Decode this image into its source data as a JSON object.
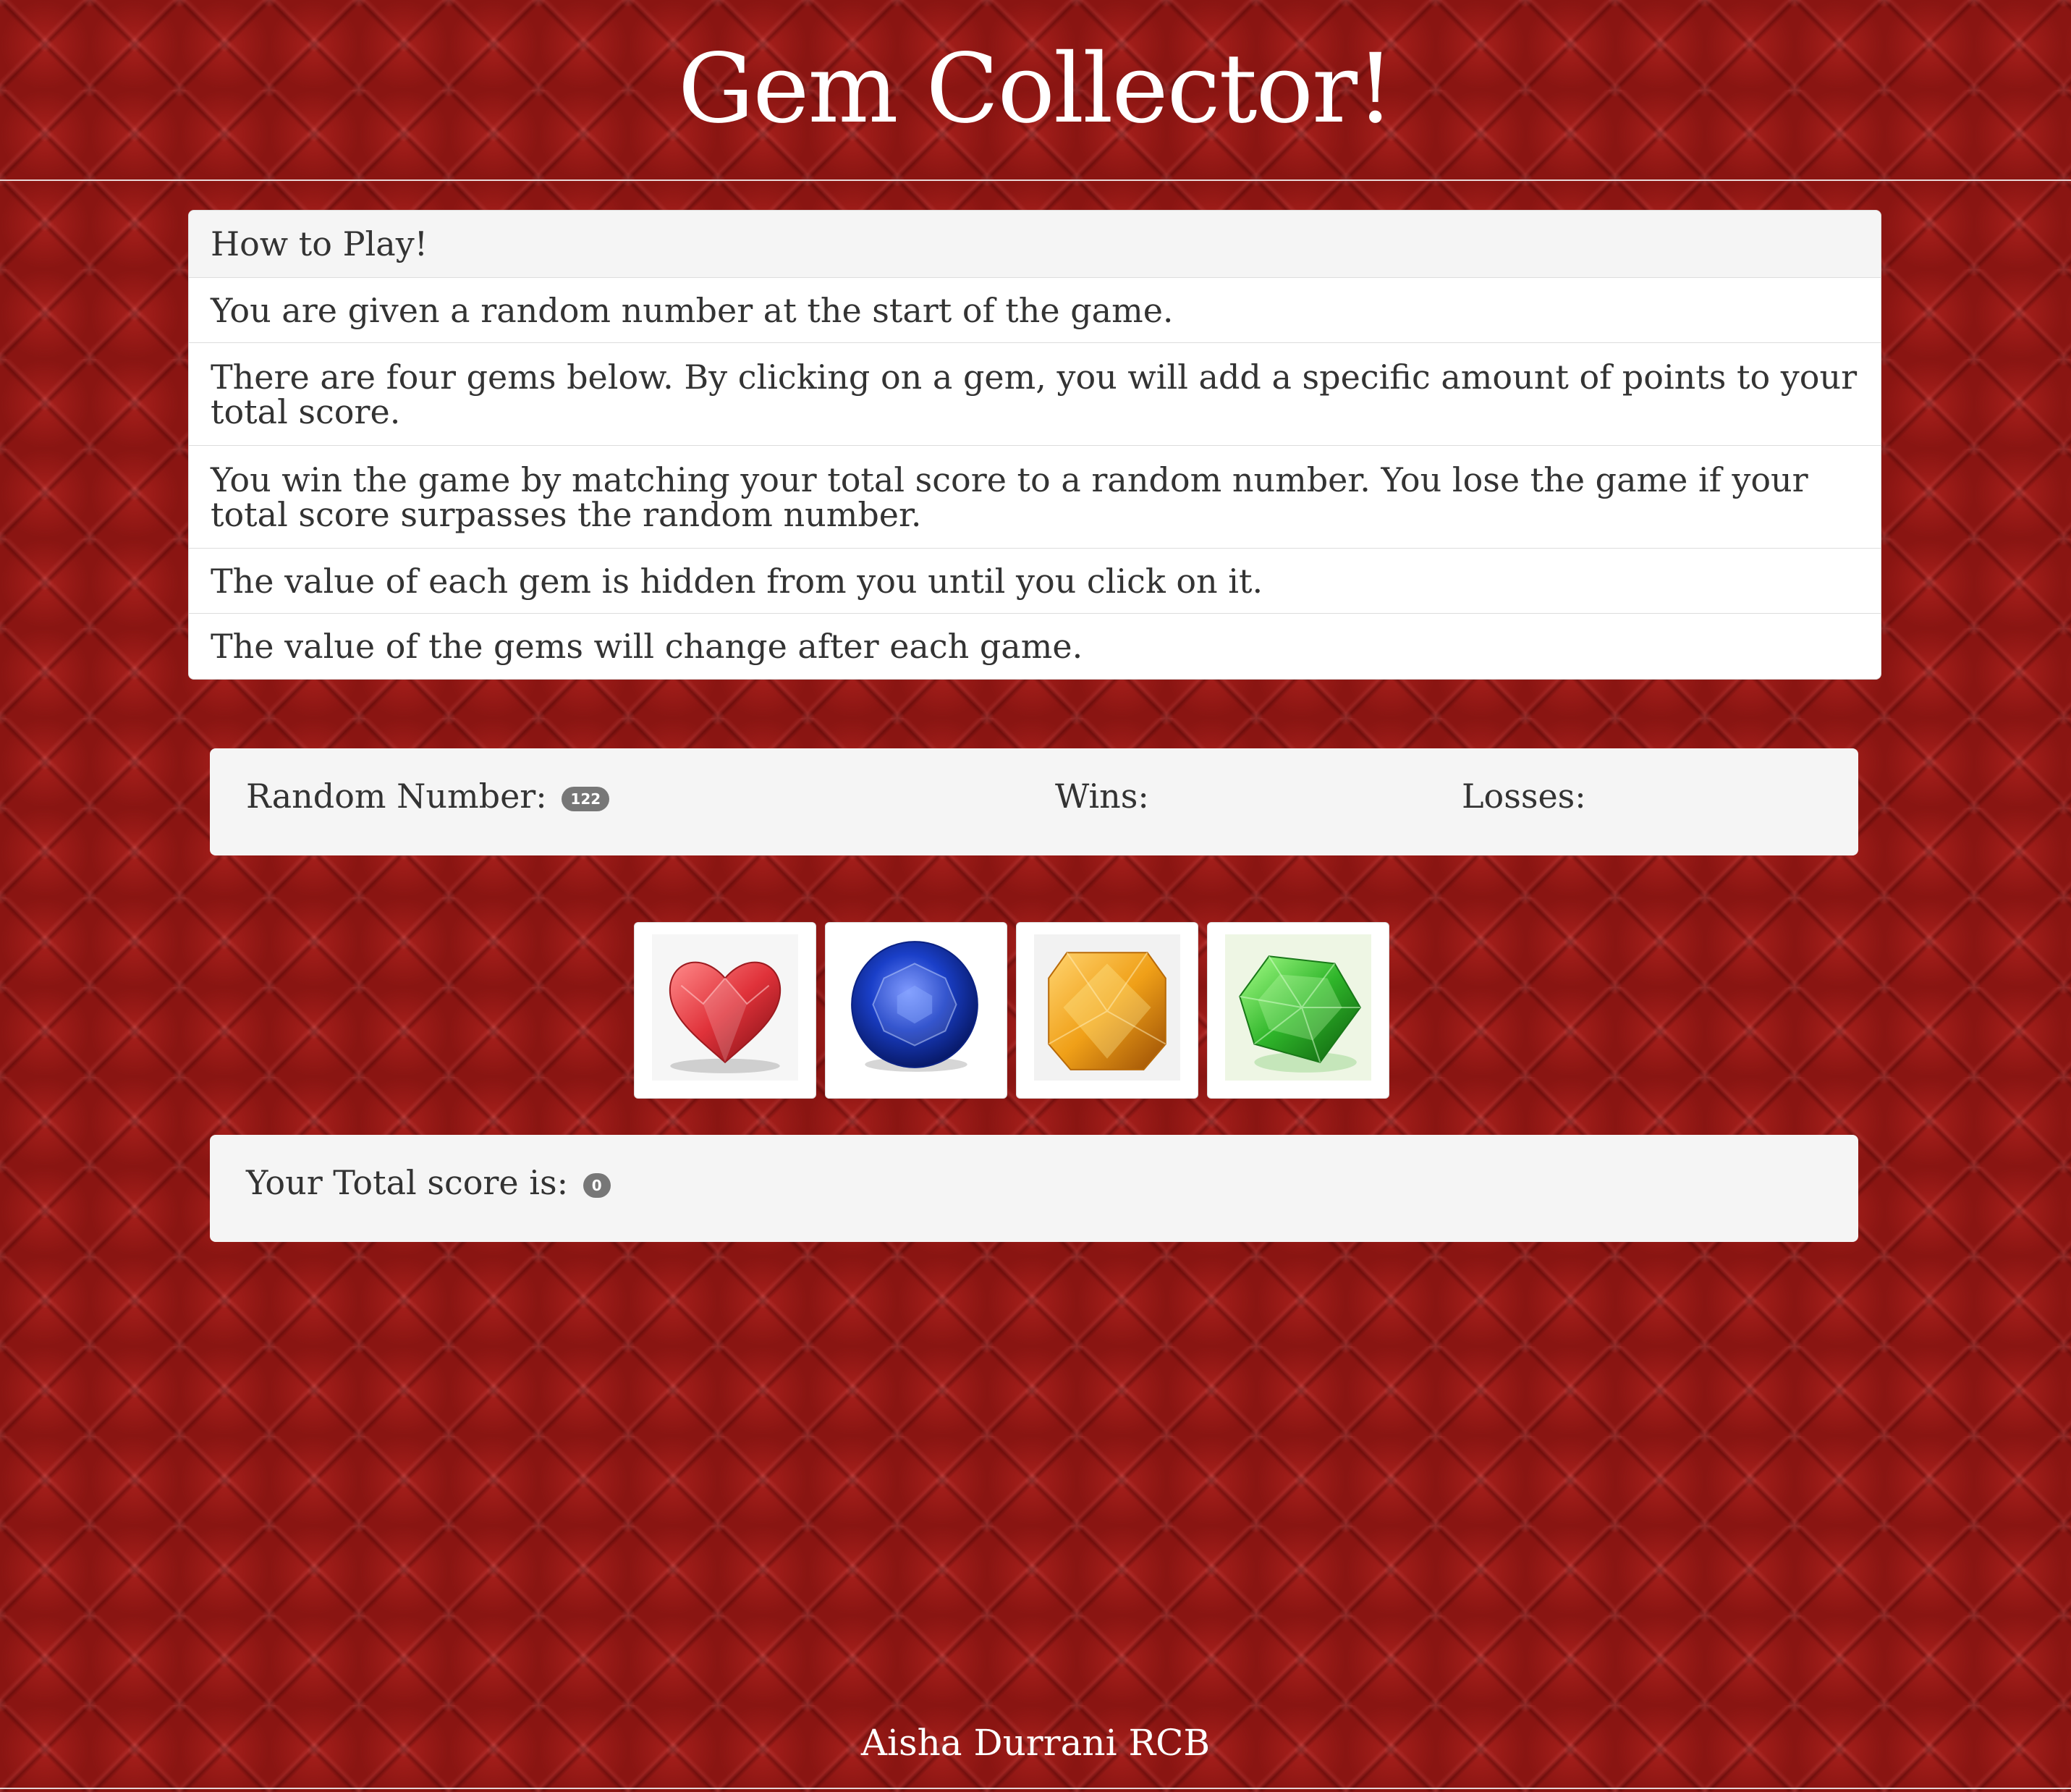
{
  "header": {
    "title": "Gem Collector!"
  },
  "instructions": {
    "heading": "How to Play!",
    "items": [
      "You are given a random number at the start of the game.",
      "There are four gems below. By clicking on a gem, you will add a specific amount of points to your total score.",
      "You win the game by matching your total score to a random number. You lose the game if your total score surpasses the random number.",
      "The value of each gem is hidden from you until you click on it.",
      "The value of the gems will change after each game."
    ]
  },
  "stats": {
    "random_label": "Random Number:",
    "random_value": "122",
    "wins_label": "Wins:",
    "losses_label": "Losses:"
  },
  "gems": [
    {
      "name": "red heart gem",
      "color": "#e0323a"
    },
    {
      "name": "blue round gem",
      "color": "#1a3fc8"
    },
    {
      "name": "amber square gem",
      "color": "#f0a018"
    },
    {
      "name": "green gem",
      "color": "#2fb52a"
    }
  ],
  "score": {
    "label": "Your Total score is:",
    "value": "0"
  },
  "footer": {
    "text": "Aisha Durrani RCB"
  }
}
